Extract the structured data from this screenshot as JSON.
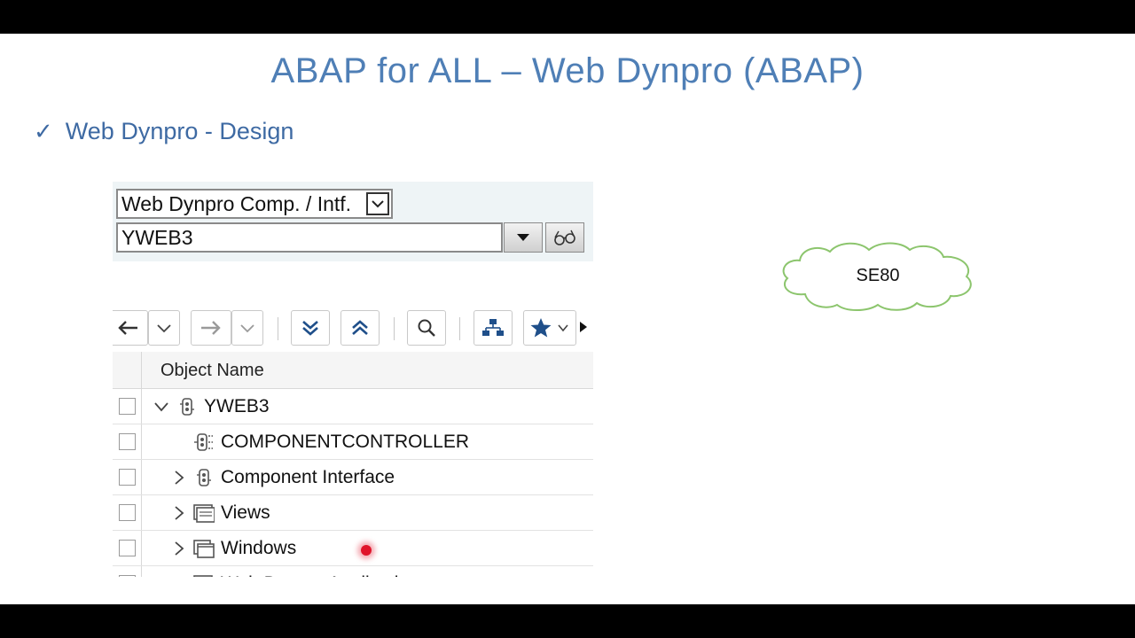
{
  "slide": {
    "title": "ABAP for ALL – Web Dynpro (ABAP)",
    "bullet": "Web Dynpro - Design",
    "cloud_label": "SE80"
  },
  "sap": {
    "object_type": "Web Dynpro Comp. / Intf.",
    "object_name_value": "YWEB3",
    "tree_header": "Object Name",
    "tree_rows": [
      {
        "label": "YWEB3",
        "expander": "expanded",
        "icon": "component-icon"
      },
      {
        "label": "COMPONENTCONTROLLER",
        "expander": "none",
        "icon": "controller-icon"
      },
      {
        "label": "Component Interface",
        "expander": "collapsed",
        "icon": "component-icon"
      },
      {
        "label": "Views",
        "expander": "collapsed",
        "icon": "view-icon"
      },
      {
        "label": "Windows",
        "expander": "collapsed",
        "icon": "window-icon"
      },
      {
        "label": "Web Dynpro Applications",
        "expander": "collapsed",
        "icon": "application-icon"
      }
    ]
  },
  "colors": {
    "title_blue": "#4f7fb6",
    "bullet_blue": "#3e6aa3",
    "cloud_green": "#8cc56d",
    "panel_bg": "#eef4f6"
  }
}
